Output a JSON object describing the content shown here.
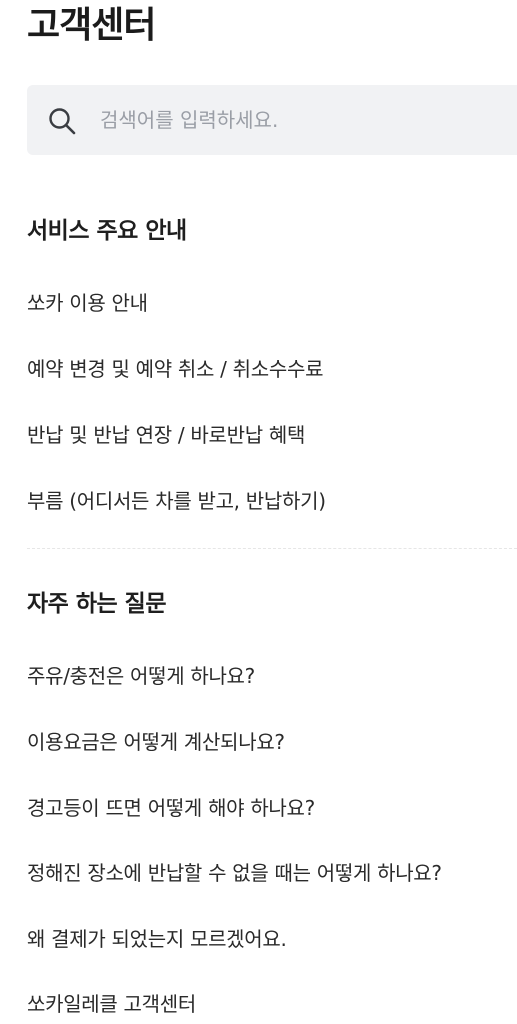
{
  "header": {
    "title": "고객센터"
  },
  "search": {
    "placeholder": "검색어를 입력하세요.",
    "value": ""
  },
  "service_guide": {
    "heading": "서비스 주요 안내",
    "items": [
      "쏘카 이용 안내",
      "예약 변경 및 예약 취소 / 취소수수료",
      "반납 및 반납 연장 / 바로반납 혜택",
      "부름 (어디서든 차를 받고, 반납하기)"
    ]
  },
  "faq": {
    "heading": "자주 하는 질문",
    "items": [
      "주유/충전은 어떻게 하나요?",
      "이용요금은 어떻게 계산되나요?",
      "경고등이 뜨면 어떻게 해야 하나요?",
      "정해진 장소에 반납할 수 없을 때는 어떻게 하나요?",
      "왜 결제가 되었는지 모르겠어요.",
      "쏘카일레클 고객센터"
    ]
  },
  "colors": {
    "search_background": "#f1f2f4",
    "placeholder": "#9a9ea6",
    "text": "#2a2a2a"
  },
  "icons": {
    "search": "search-icon"
  }
}
